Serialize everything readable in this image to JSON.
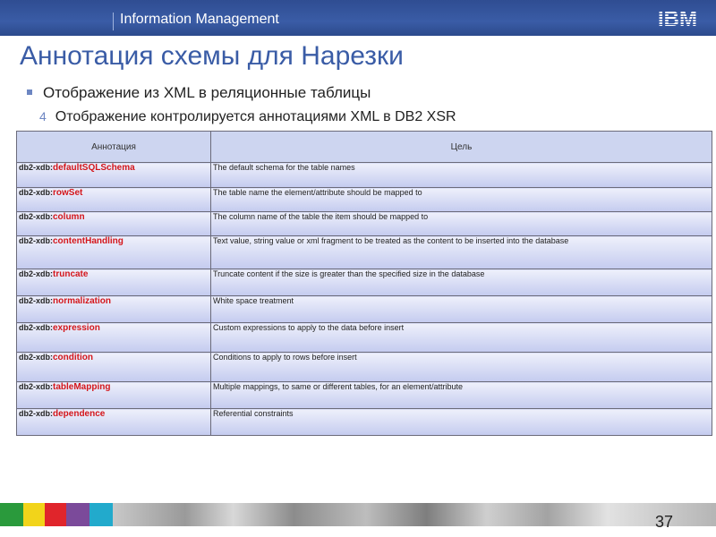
{
  "header": {
    "brand": "Information Management",
    "logo": "IBM"
  },
  "slide": {
    "title": "Аннотация схемы для Нарезки",
    "bullet1": "Отображение из XML в реляционные таблицы",
    "bullet2": "Отображение контролируется аннотациями XML в DB2 XSR",
    "bullet2_marker": "4"
  },
  "table": {
    "headers": [
      "Аннотация",
      "Цель"
    ],
    "prefix": "db2-xdb:",
    "rows": [
      {
        "name": "defaultSQLSchema",
        "desc": "The default schema for the table names"
      },
      {
        "name": "rowSet",
        "desc": "The table name the element/attribute should be mapped to"
      },
      {
        "name": "column",
        "desc": "The column name of the table the item should be mapped to"
      },
      {
        "name": "contentHandling",
        "desc": "Text value, string value or xml fragment to be treated as the content to be inserted into the database"
      },
      {
        "name": "truncate",
        "desc": "Truncate content if the size is greater than the specified size in the database"
      },
      {
        "name": "normalization",
        "desc": "White space treatment"
      },
      {
        "name": "expression",
        "desc": "Custom expressions to apply to the data before insert"
      },
      {
        "name": "condition",
        "desc": "Conditions to apply to rows before insert"
      },
      {
        "name": "tableMapping",
        "desc": "Multiple mappings, to same or different tables, for an element/attribute"
      },
      {
        "name": "dependence",
        "desc": "Referential constraints"
      }
    ]
  },
  "footer": {
    "page_number": "37",
    "colors": [
      "#2a9a3c",
      "#f2d41a",
      "#e0252b",
      "#7b4a9a",
      "#22aacc"
    ]
  }
}
